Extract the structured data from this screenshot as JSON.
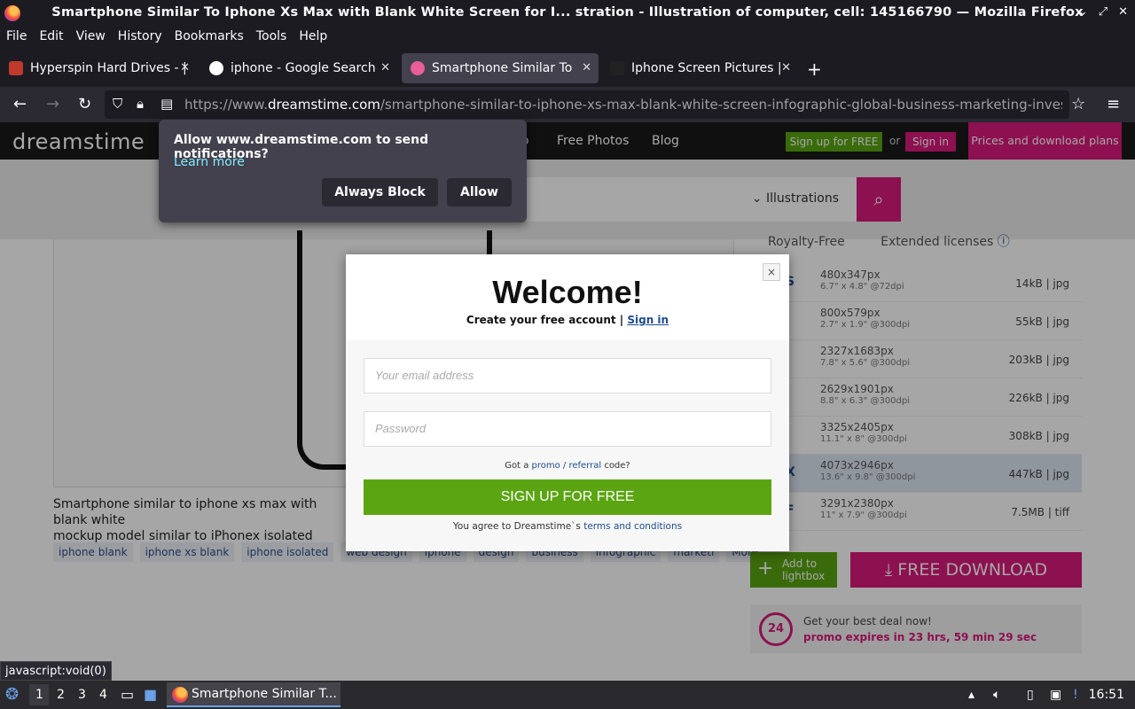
{
  "window": {
    "title": "Smartphone Similar To Iphone Xs Max with Blank White Screen for I... stration - Illustration of computer, cell: 145166790 — Mozilla Firefox"
  },
  "menu": [
    "File",
    "Edit",
    "View",
    "History",
    "Bookmarks",
    "Tools",
    "Help"
  ],
  "tabs": [
    {
      "label": "Hyperspin Hard Drives - |",
      "color": "#c0392b"
    },
    {
      "label": "iphone - Google Search",
      "color": "#ffffff"
    },
    {
      "label": "Smartphone Similar To Ip",
      "color": "#e85d9a"
    },
    {
      "label": "Iphone Screen Pictures |",
      "color": "#222222"
    }
  ],
  "urlbar": {
    "prefix": "https://www.",
    "domain": "dreamstime.com",
    "path": "/smartphone-similar-to-iphone-xs-max-blank-white-screen-infographic-global-business-marketing-investment-pl"
  },
  "site": {
    "logo": "dreamstime",
    "nav": [
      "Free Photos",
      "Blog"
    ],
    "nav_partial": "o",
    "signup": "Sign up for FREE",
    "or": "or",
    "signin": "Sign in",
    "plans": "Prices and download plans",
    "search_category": "Illustrations",
    "caption_line1": "Smartphone similar to iphone xs max with blank white",
    "caption_line2": "mockup model similar to iPhonex isolated illustration",
    "tags": [
      "iphone blank",
      "iphone xs blank",
      "iphone isolated",
      "web design",
      "iphone",
      "design",
      "business",
      "infographic",
      "marketi"
    ],
    "more": "More",
    "right_tabs": [
      "Royalty-Free",
      "Extended licenses"
    ],
    "sizes": [
      {
        "code": "S",
        "dim": "480x347px",
        "sub": "6.7\" x 4.8\" @72dpi",
        "fs": "14kB | jpg"
      },
      {
        "code": "",
        "dim": "800x579px",
        "sub": "2.7\" x 1.9\" @300dpi",
        "fs": "55kB | jpg"
      },
      {
        "code": "",
        "dim": "2327x1683px",
        "sub": "7.8\" x 5.6\" @300dpi",
        "fs": "203kB | jpg"
      },
      {
        "code": "",
        "dim": "2629x1901px",
        "sub": "8.8\" x 6.3\" @300dpi",
        "fs": "226kB | jpg"
      },
      {
        "code": "",
        "dim": "3325x2405px",
        "sub": "11.1\" x 8\" @300dpi",
        "fs": "308kB | jpg"
      },
      {
        "code": "X",
        "dim": "4073x2946px",
        "sub": "13.6\" x 9.8\" @300dpi",
        "fs": "447kB | jpg"
      },
      {
        "code": "F",
        "dim": "3291x2380px",
        "sub": "11\" x 7.9\" @300dpi",
        "fs": "7.5MB | tiff"
      }
    ],
    "add_lightbox": "Add to lightbox",
    "free_download": "FREE DOWNLOAD",
    "deal_icon": "24",
    "deal_title": "Get your best deal now!",
    "deal_timer": "promo expires in 23 hrs, 59 min 29 sec"
  },
  "modal": {
    "welcome": "Welcome!",
    "sub_text": "Create your free account | ",
    "sub_link": "Sign in",
    "email_placeholder": "Your email address",
    "password_placeholder": "Password",
    "promo_pre": "Got a ",
    "promo_link": "promo / referral",
    "promo_post": " code?",
    "signup": "SIGN UP FOR FREE",
    "agree_pre": "You agree to Dreamstime`s ",
    "agree_link": "terms and conditions",
    "close": "×"
  },
  "notification": {
    "question": "Allow www.dreamstime.com to send notifications?",
    "learn_more": "Learn more",
    "block": "Always Block",
    "allow": "Allow"
  },
  "status_link": "javascript:void(0)",
  "taskbar": {
    "workspaces": [
      "1",
      "2",
      "3",
      "4"
    ],
    "app_label": "Smartphone Similar T...",
    "clock": "16:51"
  }
}
